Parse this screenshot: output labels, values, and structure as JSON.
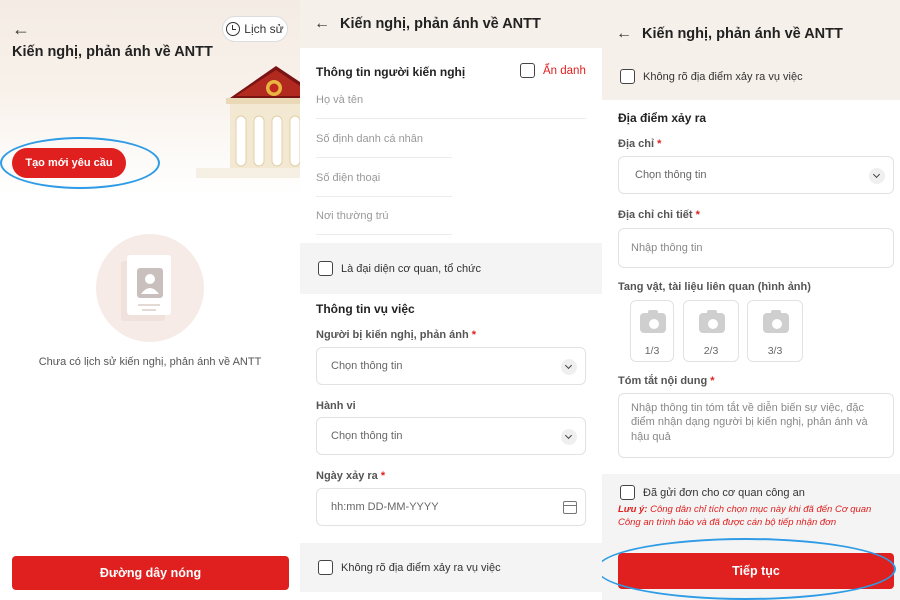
{
  "screen1": {
    "history_label": "Lịch sử",
    "title": "Kiến nghị, phản ánh về ANTT",
    "create_button": "Tạo mới yêu cầu",
    "empty_text": "Chưa có lịch sử kiến nghị, phản ánh về ANTT",
    "hotline_button": "Đường dây nóng"
  },
  "screen2": {
    "header_title": "Kiến nghị, phản ánh về ANTT",
    "section_person": "Thông tin người kiến nghị",
    "anonymous_label": "Ẩn danh",
    "fields": {
      "full_name": "Họ và tên",
      "id_number": "Số định danh cá nhân",
      "phone": "Số điện thoại",
      "residence": "Nơi thường trú"
    },
    "org_representative": "Là đại diện cơ quan, tổ chức",
    "section_case": "Thông tin vụ việc",
    "target_label": "Người bị kiến nghị, phản ánh",
    "target_value": "Chọn thông tin",
    "behavior_label": "Hành vi",
    "behavior_value": "Chọn thông tin",
    "date_label": "Ngày xảy ra",
    "date_placeholder": "hh:mm DD-MM-YYYY",
    "unknown_location": "Không rõ địa điểm xảy ra vụ việc",
    "required_mark": "*"
  },
  "screen3": {
    "header_title": "Kiến nghị, phản ánh về ANTT",
    "unknown_location": "Không rõ địa điểm xảy ra vụ việc",
    "section_location": "Địa điểm xảy ra",
    "address_label": "Địa chỉ",
    "address_value": "Chọn thông tin",
    "address_detail_label": "Địa chỉ chi tiết",
    "address_detail_placeholder": "Nhập thông tin",
    "evidence_label": "Tang vật, tài liệu liên quan (hình ảnh)",
    "image_slots": [
      "1/3",
      "2/3",
      "3/3"
    ],
    "summary_label": "Tóm tắt nội dung",
    "summary_placeholder": "Nhập thông tin tóm tắt về diễn biến sự việc, đặc điểm nhận dạng người bị kiến nghị, phản ánh và hậu quả",
    "sent_to_police": "Đã gửi đơn cho cơ quan công an",
    "note_prefix": "Lưu ý:",
    "note_text": "Công dân chỉ tích chọn mục này khi đã đến Cơ quan Công an trình báo và đã được cán bộ tiếp nhận đơn",
    "continue_button": "Tiếp tục",
    "required_mark": "*"
  },
  "colors": {
    "brand_red": "#e01f1f",
    "highlight_ring": "#2e9be6",
    "header_bg": "#f6f0ea"
  },
  "icons": [
    "back-arrow-icon",
    "clock-icon",
    "checkbox-icon",
    "chevron-down-icon",
    "calendar-icon",
    "camera-icon",
    "user-document-icon"
  ]
}
